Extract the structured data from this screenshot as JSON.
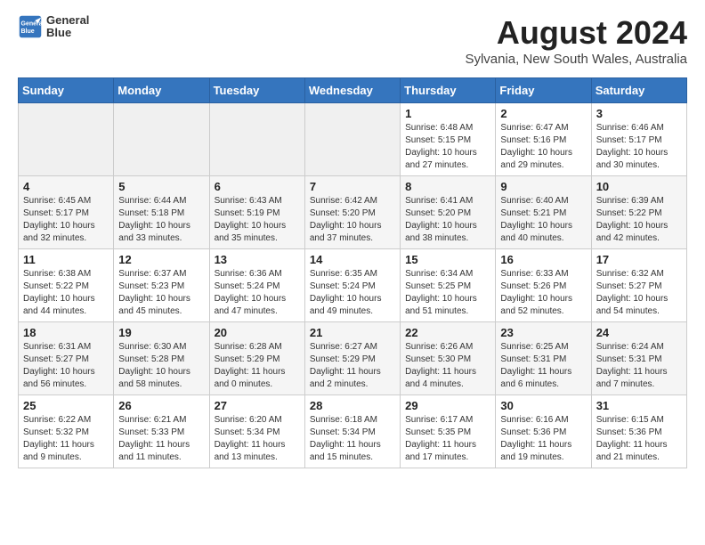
{
  "header": {
    "logo_line1": "General",
    "logo_line2": "Blue",
    "month": "August 2024",
    "location": "Sylvania, New South Wales, Australia"
  },
  "weekdays": [
    "Sunday",
    "Monday",
    "Tuesday",
    "Wednesday",
    "Thursday",
    "Friday",
    "Saturday"
  ],
  "rows": [
    [
      {
        "day": "",
        "info": ""
      },
      {
        "day": "",
        "info": ""
      },
      {
        "day": "",
        "info": ""
      },
      {
        "day": "",
        "info": ""
      },
      {
        "day": "1",
        "info": "Sunrise: 6:48 AM\nSunset: 5:15 PM\nDaylight: 10 hours\nand 27 minutes."
      },
      {
        "day": "2",
        "info": "Sunrise: 6:47 AM\nSunset: 5:16 PM\nDaylight: 10 hours\nand 29 minutes."
      },
      {
        "day": "3",
        "info": "Sunrise: 6:46 AM\nSunset: 5:17 PM\nDaylight: 10 hours\nand 30 minutes."
      }
    ],
    [
      {
        "day": "4",
        "info": "Sunrise: 6:45 AM\nSunset: 5:17 PM\nDaylight: 10 hours\nand 32 minutes."
      },
      {
        "day": "5",
        "info": "Sunrise: 6:44 AM\nSunset: 5:18 PM\nDaylight: 10 hours\nand 33 minutes."
      },
      {
        "day": "6",
        "info": "Sunrise: 6:43 AM\nSunset: 5:19 PM\nDaylight: 10 hours\nand 35 minutes."
      },
      {
        "day": "7",
        "info": "Sunrise: 6:42 AM\nSunset: 5:20 PM\nDaylight: 10 hours\nand 37 minutes."
      },
      {
        "day": "8",
        "info": "Sunrise: 6:41 AM\nSunset: 5:20 PM\nDaylight: 10 hours\nand 38 minutes."
      },
      {
        "day": "9",
        "info": "Sunrise: 6:40 AM\nSunset: 5:21 PM\nDaylight: 10 hours\nand 40 minutes."
      },
      {
        "day": "10",
        "info": "Sunrise: 6:39 AM\nSunset: 5:22 PM\nDaylight: 10 hours\nand 42 minutes."
      }
    ],
    [
      {
        "day": "11",
        "info": "Sunrise: 6:38 AM\nSunset: 5:22 PM\nDaylight: 10 hours\nand 44 minutes."
      },
      {
        "day": "12",
        "info": "Sunrise: 6:37 AM\nSunset: 5:23 PM\nDaylight: 10 hours\nand 45 minutes."
      },
      {
        "day": "13",
        "info": "Sunrise: 6:36 AM\nSunset: 5:24 PM\nDaylight: 10 hours\nand 47 minutes."
      },
      {
        "day": "14",
        "info": "Sunrise: 6:35 AM\nSunset: 5:24 PM\nDaylight: 10 hours\nand 49 minutes."
      },
      {
        "day": "15",
        "info": "Sunrise: 6:34 AM\nSunset: 5:25 PM\nDaylight: 10 hours\nand 51 minutes."
      },
      {
        "day": "16",
        "info": "Sunrise: 6:33 AM\nSunset: 5:26 PM\nDaylight: 10 hours\nand 52 minutes."
      },
      {
        "day": "17",
        "info": "Sunrise: 6:32 AM\nSunset: 5:27 PM\nDaylight: 10 hours\nand 54 minutes."
      }
    ],
    [
      {
        "day": "18",
        "info": "Sunrise: 6:31 AM\nSunset: 5:27 PM\nDaylight: 10 hours\nand 56 minutes."
      },
      {
        "day": "19",
        "info": "Sunrise: 6:30 AM\nSunset: 5:28 PM\nDaylight: 10 hours\nand 58 minutes."
      },
      {
        "day": "20",
        "info": "Sunrise: 6:28 AM\nSunset: 5:29 PM\nDaylight: 11 hours\nand 0 minutes."
      },
      {
        "day": "21",
        "info": "Sunrise: 6:27 AM\nSunset: 5:29 PM\nDaylight: 11 hours\nand 2 minutes."
      },
      {
        "day": "22",
        "info": "Sunrise: 6:26 AM\nSunset: 5:30 PM\nDaylight: 11 hours\nand 4 minutes."
      },
      {
        "day": "23",
        "info": "Sunrise: 6:25 AM\nSunset: 5:31 PM\nDaylight: 11 hours\nand 6 minutes."
      },
      {
        "day": "24",
        "info": "Sunrise: 6:24 AM\nSunset: 5:31 PM\nDaylight: 11 hours\nand 7 minutes."
      }
    ],
    [
      {
        "day": "25",
        "info": "Sunrise: 6:22 AM\nSunset: 5:32 PM\nDaylight: 11 hours\nand 9 minutes."
      },
      {
        "day": "26",
        "info": "Sunrise: 6:21 AM\nSunset: 5:33 PM\nDaylight: 11 hours\nand 11 minutes."
      },
      {
        "day": "27",
        "info": "Sunrise: 6:20 AM\nSunset: 5:34 PM\nDaylight: 11 hours\nand 13 minutes."
      },
      {
        "day": "28",
        "info": "Sunrise: 6:18 AM\nSunset: 5:34 PM\nDaylight: 11 hours\nand 15 minutes."
      },
      {
        "day": "29",
        "info": "Sunrise: 6:17 AM\nSunset: 5:35 PM\nDaylight: 11 hours\nand 17 minutes."
      },
      {
        "day": "30",
        "info": "Sunrise: 6:16 AM\nSunset: 5:36 PM\nDaylight: 11 hours\nand 19 minutes."
      },
      {
        "day": "31",
        "info": "Sunrise: 6:15 AM\nSunset: 5:36 PM\nDaylight: 11 hours\nand 21 minutes."
      }
    ]
  ]
}
